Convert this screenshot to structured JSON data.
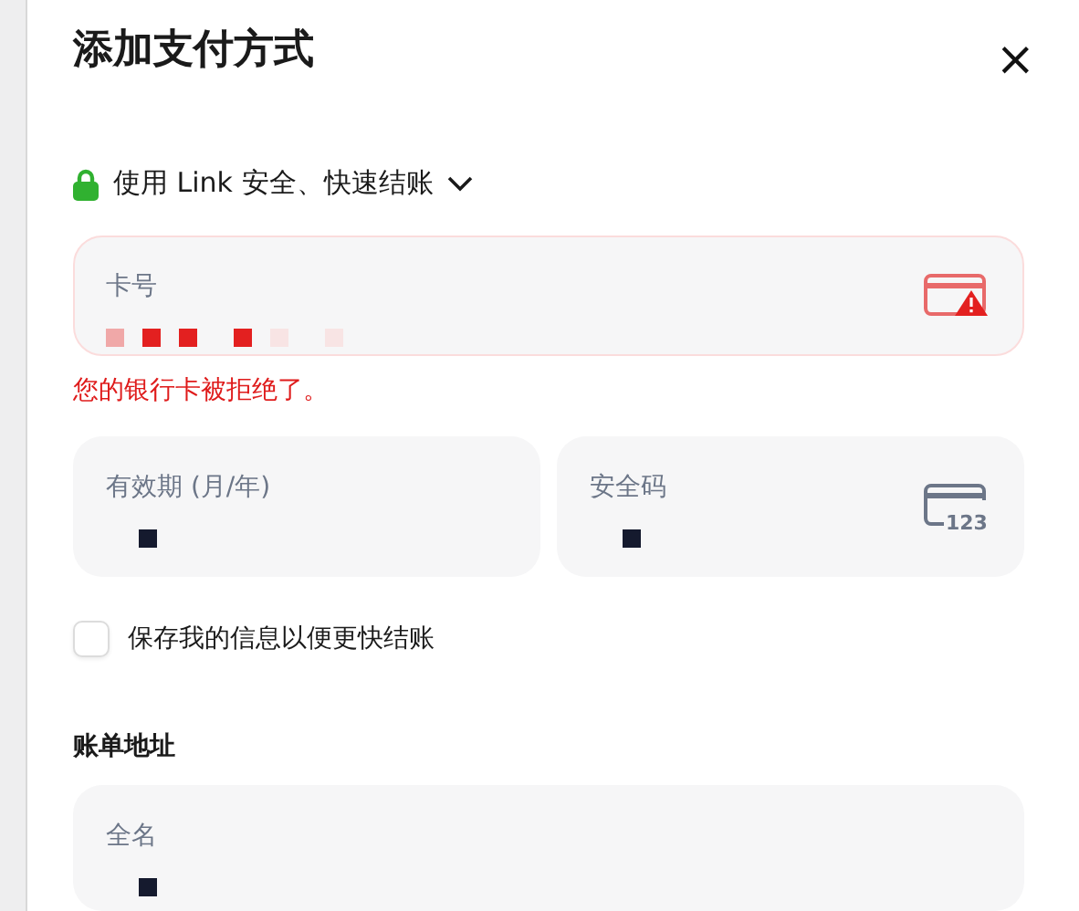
{
  "dialog": {
    "title": "添加支付方式",
    "close": "×"
  },
  "link_row": {
    "label": "使用 Link 安全、快速结账",
    "expanded": false
  },
  "card_number": {
    "label": "卡号",
    "error": true
  },
  "error_message": "您的银行卡被拒绝了。",
  "expiry": {
    "label": "有效期 (月/年)"
  },
  "cvc": {
    "label": "安全码",
    "icon_text": "123"
  },
  "save_info": {
    "label": "保存我的信息以便更快结账",
    "checked": false
  },
  "billing": {
    "heading": "账单地址",
    "fields": [
      {
        "label": "全名"
      }
    ]
  }
}
